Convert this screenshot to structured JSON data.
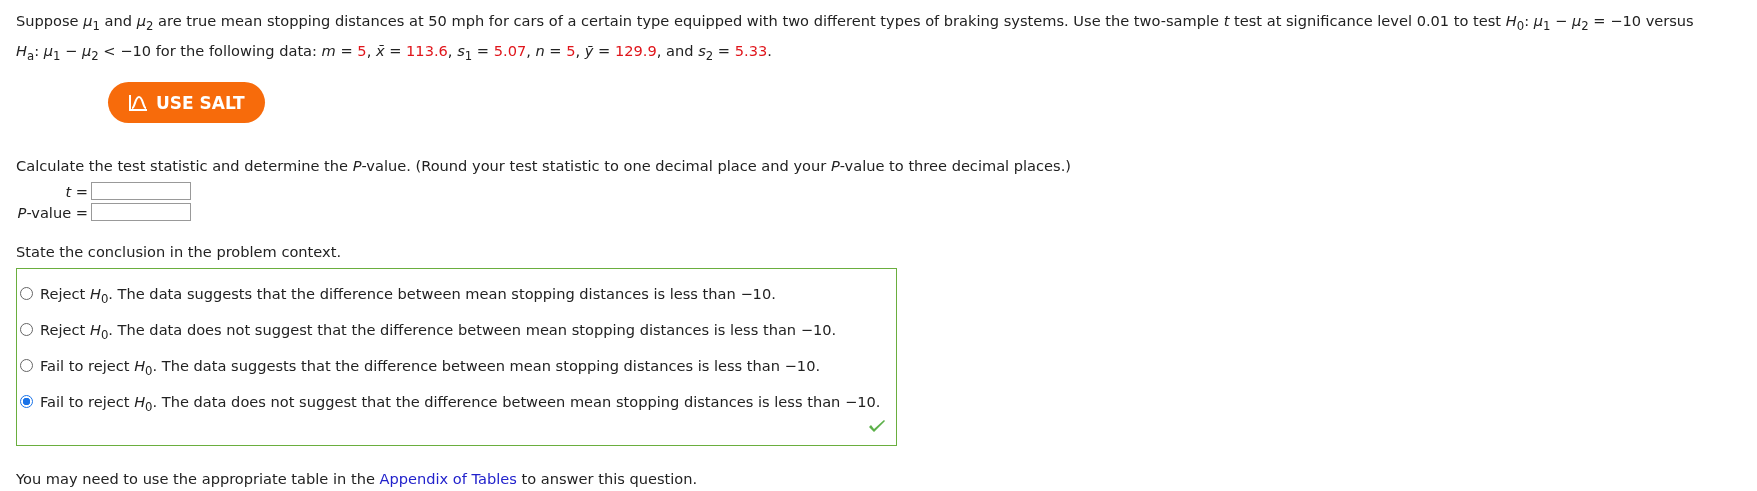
{
  "question": {
    "lines": [
      [
        {
          "kind": "text",
          "text": "Suppose *μ*$_{1}$ and *μ*$_{2}$ are true mean stopping distances at 50 mph for cars of a certain type equipped with two different types of braking systems. Use the two-sample *t* test at significance level 0.01 to test *H*$_{0}$: *μ*$_{1}$ − *μ*$_{2}$ = −10 versus"
        }
      ],
      [
        {
          "kind": "text",
          "text": "*H*$_{a}$: *μ*$_{1}$ − *μ*$_{2}$ < −10 for the following data: *m* = "
        },
        {
          "kind": "value",
          "text": "5"
        },
        {
          "kind": "text",
          "text": ", *x̄* = "
        },
        {
          "kind": "value",
          "text": "113.6"
        },
        {
          "kind": "text",
          "text": ", *s*$_{1}$ = "
        },
        {
          "kind": "value",
          "text": "5.07"
        },
        {
          "kind": "text",
          "text": ", *n* = "
        },
        {
          "kind": "value",
          "text": "5"
        },
        {
          "kind": "text",
          "text": ", *ȳ* = "
        },
        {
          "kind": "value",
          "text": "129.9"
        },
        {
          "kind": "text",
          "text": ", and *s*$_{2}$ = "
        },
        {
          "kind": "value",
          "text": "5.33"
        },
        {
          "kind": "text",
          "text": "."
        }
      ]
    ]
  },
  "salt_button": {
    "label": "USE SALT"
  },
  "instruction": "Calculate the test statistic and determine the *P*-value. (Round your test statistic to one decimal place and your *P*-value to three decimal places.)",
  "answers": [
    {
      "label": "*t* ="
    },
    {
      "label": "*P*-value ="
    }
  ],
  "conclusion_prompt": "State the conclusion in the problem context.",
  "options": [
    {
      "text": "Reject *H*$_{0}$. The data suggests that the difference between mean stopping distances is less than −10.",
      "selected": false
    },
    {
      "text": "Reject *H*$_{0}$. The data does not suggest that the difference between mean stopping distances is less than −10.",
      "selected": false
    },
    {
      "text": "Fail to reject *H*$_{0}$. The data suggests that the difference between mean stopping distances is less than −10.",
      "selected": false
    },
    {
      "text": "Fail to reject *H*$_{0}$. The data does not suggest that the difference between mean stopping distances is less than −10.",
      "selected": true
    }
  ],
  "correct": true,
  "footer": {
    "before": "You may need to use the appropriate table in the",
    "link": "Appendix of Tables",
    "after": "to answer this question."
  }
}
